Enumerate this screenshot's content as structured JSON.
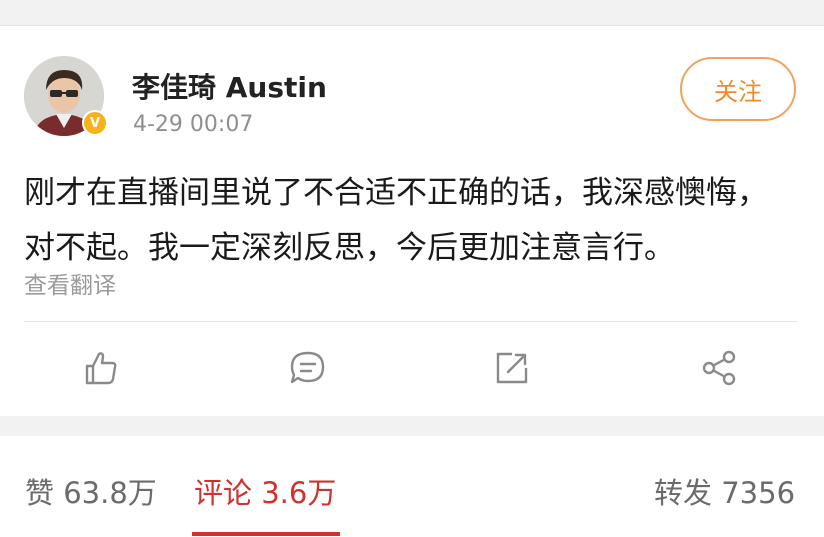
{
  "post": {
    "username": "李佳琦 Austin",
    "timestamp": "4-29 00:07",
    "follow_label": "关注",
    "text": "刚才在直播间里说了不合适不正确的话，我深感懊悔，对不起。我一定深刻反思，今后更加注意言行。",
    "translate_label": "查看翻译",
    "verified_badge": "V"
  },
  "actions": [
    {
      "name": "like",
      "icon": "thumbs-up-icon"
    },
    {
      "name": "comment",
      "icon": "comment-icon"
    },
    {
      "name": "repost",
      "icon": "repost-icon"
    },
    {
      "name": "share",
      "icon": "share-icon"
    }
  ],
  "stats": {
    "likes": "赞 63.8万",
    "comments": "评论 3.6万",
    "reposts": "转发 7356"
  },
  "colors": {
    "accent_orange": "#f08b2c",
    "active_red": "#d0312d",
    "verified_gold": "#f5b21d"
  }
}
